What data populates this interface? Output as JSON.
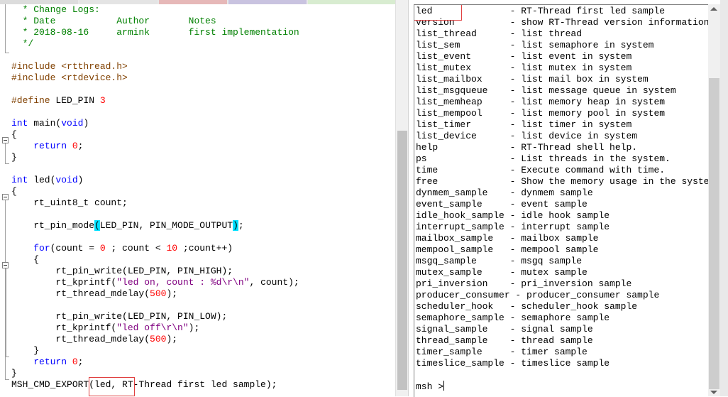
{
  "colors": {
    "comment": "#008000",
    "preprocessor": "#804000",
    "keyword": "#0000ff",
    "number": "#ff0000",
    "string": "#808080",
    "brace_match_bg": "#00e0ff",
    "highlight_box": "#e04040"
  },
  "icons": {
    "fold_toggle": "minus-box-icon",
    "scroll_up": "arrow-up-icon",
    "scroll_down": "arrow-down-icon"
  },
  "editor": {
    "lines": [
      {
        "t": [
          {
            "c": "cm",
            "v": "  * Change Logs:"
          }
        ]
      },
      {
        "t": [
          {
            "c": "cm",
            "v": "  * Date           Author       Notes"
          }
        ]
      },
      {
        "t": [
          {
            "c": "cm",
            "v": "  * 2018-08-16     armink       first implementation"
          }
        ]
      },
      {
        "t": [
          {
            "c": "cm",
            "v": "  */"
          }
        ]
      },
      {
        "t": []
      },
      {
        "t": [
          {
            "c": "pp",
            "v": "#include <rtthread.h>"
          }
        ]
      },
      {
        "t": [
          {
            "c": "pp",
            "v": "#include <rtdevice.h>"
          }
        ]
      },
      {
        "t": []
      },
      {
        "t": [
          {
            "c": "pp",
            "v": "#define"
          },
          {
            "c": "",
            "v": " LED_PIN "
          },
          {
            "c": "num",
            "v": "3"
          }
        ]
      },
      {
        "t": []
      },
      {
        "t": [
          {
            "c": "kw",
            "v": "int"
          },
          {
            "c": "",
            "v": " main("
          },
          {
            "c": "kw",
            "v": "void"
          },
          {
            "c": "",
            "v": ")"
          }
        ]
      },
      {
        "t": [
          {
            "c": "",
            "v": "{"
          }
        ]
      },
      {
        "t": [
          {
            "c": "",
            "v": "    "
          },
          {
            "c": "kw",
            "v": "return"
          },
          {
            "c": "",
            "v": " "
          },
          {
            "c": "num",
            "v": "0"
          },
          {
            "c": "",
            "v": ";"
          }
        ]
      },
      {
        "t": [
          {
            "c": "",
            "v": "}"
          }
        ]
      },
      {
        "t": []
      },
      {
        "t": [
          {
            "c": "kw",
            "v": "int"
          },
          {
            "c": "",
            "v": " led("
          },
          {
            "c": "kw",
            "v": "void"
          },
          {
            "c": "",
            "v": ")"
          }
        ]
      },
      {
        "t": [
          {
            "c": "",
            "v": "{"
          }
        ]
      },
      {
        "t": [
          {
            "c": "",
            "v": "    rt_uint8_t count;"
          }
        ]
      },
      {
        "t": []
      },
      {
        "t": [
          {
            "c": "",
            "v": "    rt_pin_mode"
          },
          {
            "c": "brc",
            "v": "("
          },
          {
            "c": "",
            "v": "LED_PIN, PIN_MODE_OUTPUT"
          },
          {
            "c": "brc",
            "v": ")"
          },
          {
            "c": "",
            "v": ";"
          }
        ]
      },
      {
        "t": []
      },
      {
        "t": [
          {
            "c": "",
            "v": "    "
          },
          {
            "c": "kw",
            "v": "for"
          },
          {
            "c": "",
            "v": "(count = "
          },
          {
            "c": "num",
            "v": "0"
          },
          {
            "c": "",
            "v": " ; count < "
          },
          {
            "c": "num",
            "v": "10"
          },
          {
            "c": "",
            "v": " ;count++)"
          }
        ]
      },
      {
        "t": [
          {
            "c": "",
            "v": "    {"
          }
        ]
      },
      {
        "t": [
          {
            "c": "",
            "v": "        rt_pin_write(LED_PIN, PIN_HIGH);"
          }
        ]
      },
      {
        "t": [
          {
            "c": "",
            "v": "        rt_kprintf("
          },
          {
            "c": "str2",
            "v": "\"led on, count : %d\\r\\n\""
          },
          {
            "c": "",
            "v": ", count);"
          }
        ]
      },
      {
        "t": [
          {
            "c": "",
            "v": "        rt_thread_mdelay("
          },
          {
            "c": "num",
            "v": "500"
          },
          {
            "c": "",
            "v": ");"
          }
        ]
      },
      {
        "t": []
      },
      {
        "t": [
          {
            "c": "",
            "v": "        rt_pin_write(LED_PIN, PIN_LOW);"
          }
        ]
      },
      {
        "t": [
          {
            "c": "",
            "v": "        rt_kprintf("
          },
          {
            "c": "str2",
            "v": "\"led off\\r\\n\""
          },
          {
            "c": "",
            "v": ");"
          }
        ]
      },
      {
        "t": [
          {
            "c": "",
            "v": "        rt_thread_mdelay("
          },
          {
            "c": "num",
            "v": "500"
          },
          {
            "c": "",
            "v": ");"
          }
        ]
      },
      {
        "t": [
          {
            "c": "",
            "v": "    }"
          }
        ]
      },
      {
        "t": [
          {
            "c": "",
            "v": "    "
          },
          {
            "c": "kw",
            "v": "return"
          },
          {
            "c": "",
            "v": " "
          },
          {
            "c": "num",
            "v": "0"
          },
          {
            "c": "",
            "v": ";"
          }
        ]
      },
      {
        "t": [
          {
            "c": "",
            "v": "}"
          }
        ]
      },
      {
        "t": [
          {
            "c": "",
            "v": "MSH_CMD_EXPORT(led, RT-Thread first led sample);"
          }
        ]
      }
    ]
  },
  "terminal": {
    "lines": [
      "led              - RT-Thread first led sample",
      "version          - show RT-Thread version information",
      "list_thread      - list thread",
      "list_sem         - list semaphore in system",
      "list_event       - list event in system",
      "list_mutex       - list mutex in system",
      "list_mailbox     - list mail box in system",
      "list_msgqueue    - list message queue in system",
      "list_memheap     - list memory heap in system",
      "list_mempool     - list memory pool in system",
      "list_timer       - list timer in system",
      "list_device      - list device in system",
      "help             - RT-Thread shell help.",
      "ps               - List threads in the system.",
      "time             - Execute command with time.",
      "free             - Show the memory usage in the system.",
      "dynmem_sample    - dynmem sample",
      "event_sample     - event sample",
      "idle_hook_sample - idle hook sample",
      "interrupt_sample - interrupt sample",
      "mailbox_sample   - mailbox sample",
      "mempool_sample   - mempool sample",
      "msgq_sample      - msgq sample",
      "mutex_sample     - mutex sample",
      "pri_inversion    - pri_inversion sample",
      "producer_consumer - producer_consumer sample",
      "scheduler_hook   - scheduler_hook sample",
      "semaphore_sample - semaphore sample",
      "signal_sample    - signal sample",
      "thread_sample    - thread sample",
      "timer_sample     - timer sample",
      "timeslice_sample - timeslice sample"
    ],
    "prompt": "msh >"
  }
}
